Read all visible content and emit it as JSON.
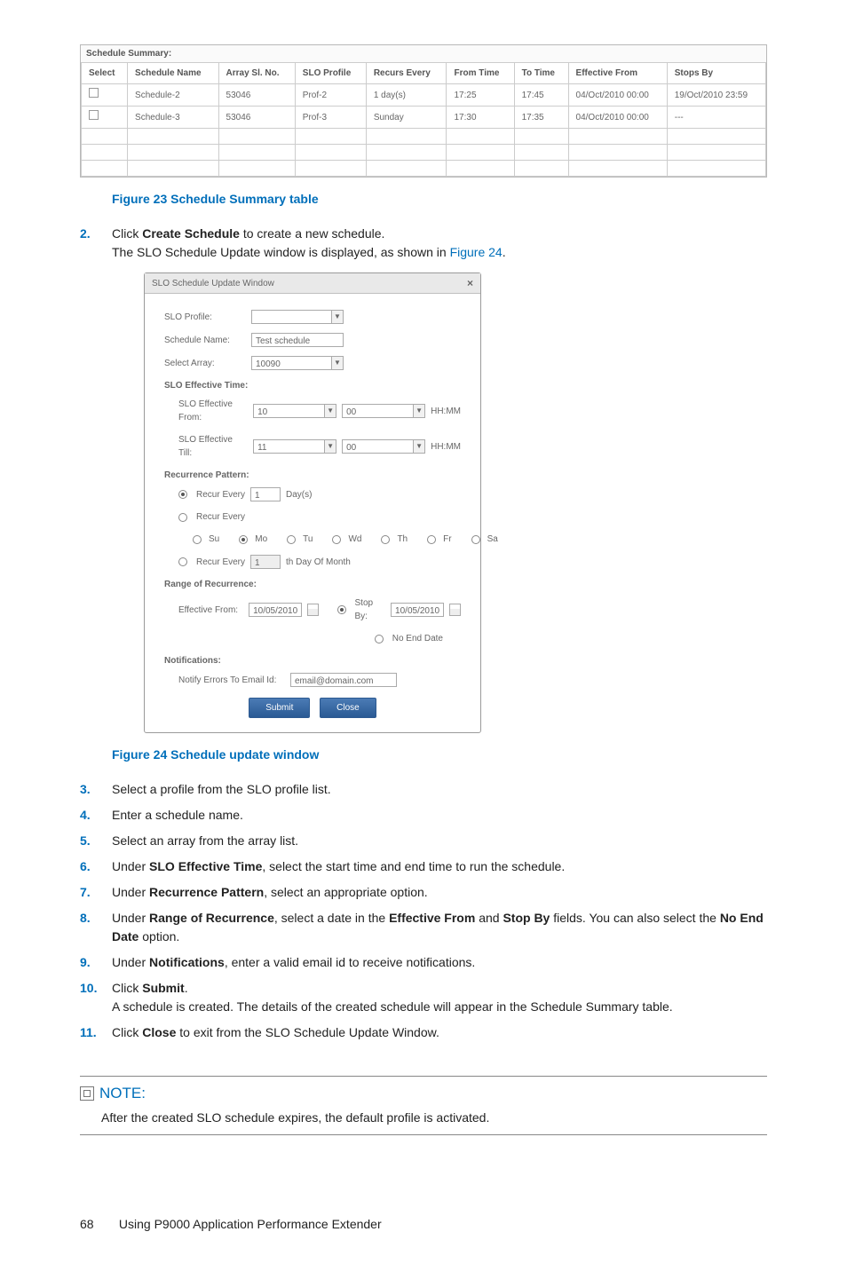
{
  "sched_summary": {
    "title": "Schedule Summary:",
    "cols": [
      "Select",
      "Schedule Name",
      "Array Sl. No.",
      "SLO Profile",
      "Recurs Every",
      "From Time",
      "To Time",
      "Effective From",
      "Stops By"
    ],
    "rows": [
      {
        "name": "Schedule-2",
        "arr": "53046",
        "profile": "Prof-2",
        "recurs": "1 day(s)",
        "from": "17:25",
        "to": "17:45",
        "eff": "04/Oct/2010 00:00",
        "stops": "19/Oct/2010 23:59"
      },
      {
        "name": "Schedule-3",
        "arr": "53046",
        "profile": "Prof-3",
        "recurs": "Sunday",
        "from": "17:30",
        "to": "17:35",
        "eff": "04/Oct/2010 00:00",
        "stops": "---"
      }
    ]
  },
  "fig23": "Figure 23 Schedule Summary table",
  "fig24": "Figure 24 Schedule update window",
  "step2": {
    "a": "Click ",
    "b": "Create Schedule",
    "c": " to create a new schedule.",
    "line2a": "The SLO Schedule Update window is displayed, as shown in ",
    "line2link": "Figure 24",
    "line2end": "."
  },
  "dialog": {
    "title": "SLO Schedule Update Window",
    "labels": {
      "profile": "SLO Profile:",
      "schedName": "Schedule Name:",
      "selectArray": "Select Array:",
      "effTimeHead": "SLO Effective Time:",
      "effFrom": "SLO Effective From:",
      "effTill": "SLO Effective Till:",
      "hhmm": "HH:MM",
      "recurHead": "Recurrence Pattern:",
      "recurEvery": "Recur Every",
      "days": "Day(s)",
      "dayOfMonth": "th Day Of Month",
      "rangeHead": "Range of Recurrence:",
      "effFrom2": "Effective From:",
      "stopBy": "Stop By:",
      "noEnd": "No End Date",
      "notifHead": "Notifications:",
      "notifEmail": "Notify Errors To Email Id:"
    },
    "values": {
      "schedName": "Test schedule",
      "arrayVal": "10090",
      "effFromH": "10",
      "effFromM": "00",
      "effTillH": "11",
      "effTillM": "00",
      "recurDays": "1",
      "dayOfMonthVal": "1",
      "effFromDate": "10/05/2010",
      "stopByDate": "10/05/2010",
      "email": "email@domain.com"
    },
    "daysOfWeek": [
      "Su",
      "Mo",
      "Tu",
      "Wd",
      "Th",
      "Fr",
      "Sa"
    ],
    "buttons": {
      "submit": "Submit",
      "close": "Close"
    }
  },
  "steps": {
    "s3": "Select a profile from the SLO profile list.",
    "s4": "Enter a schedule name.",
    "s5": "Select an array from the array list.",
    "s6a": "Under ",
    "s6b": "SLO Effective Time",
    "s6c": ", select the start time and end time to run the schedule.",
    "s7a": "Under ",
    "s7b": "Recurrence Pattern",
    "s7c": ", select an appropriate option.",
    "s8a": "Under ",
    "s8b": "Range of Recurrence",
    "s8c": ", select a date in the ",
    "s8d": "Effective From",
    "s8e": " and ",
    "s8f": "Stop By",
    "s8g": " fields. You can also select the ",
    "s8h": "No End Date",
    "s8i": " option.",
    "s9a": "Under ",
    "s9b": "Notifications",
    "s9c": ", enter a valid email id to receive notifications.",
    "s10a": "Click ",
    "s10b": "Submit",
    "s10c": ".",
    "s10d": "A schedule is created. The details of the created schedule will appear in the Schedule Summary table.",
    "s11a": "Click ",
    "s11b": "Close",
    "s11c": " to exit from the SLO Schedule Update Window."
  },
  "nums": {
    "n2": "2.",
    "n3": "3.",
    "n4": "4.",
    "n5": "5.",
    "n6": "6.",
    "n7": "7.",
    "n8": "8.",
    "n9": "9.",
    "n10": "10.",
    "n11": "11."
  },
  "note": {
    "title": "NOTE:",
    "text": "After the created SLO schedule expires, the default profile is activated."
  },
  "footer": {
    "page": "68",
    "title": "Using P9000 Application Performance Extender"
  }
}
